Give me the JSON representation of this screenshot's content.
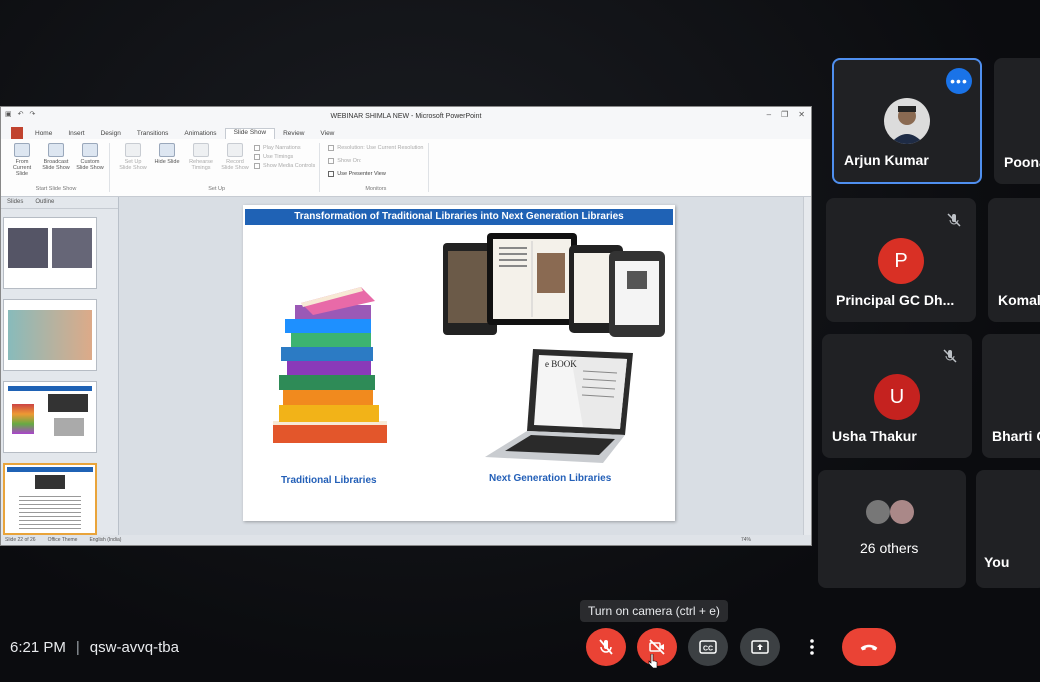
{
  "presentation": {
    "window_title": "WEBINAR SHIMLA NEW - Microsoft PowerPoint",
    "tabs": [
      "Home",
      "Insert",
      "Design",
      "Transitions",
      "Animations",
      "Slide Show",
      "Review",
      "View"
    ],
    "active_tab": "Slide Show",
    "ribbon": {
      "start_group": "Start Slide Show",
      "from_current": "From Current Slide",
      "broadcast": "Broadcast Slide Show",
      "custom": "Custom Slide Show",
      "setup_group": "Set Up",
      "setup_show": "Set Up Slide Show",
      "hide_slide": "Hide Slide",
      "rehearse": "Rehearse Timings",
      "record": "Record Slide Show",
      "play_narrations": "Play Narrations",
      "use_timings": "Use Timings",
      "show_media": "Show Media Controls",
      "monitors_group": "Monitors",
      "resolution": "Resolution: Use Current Resolution",
      "show_on": "Show On:",
      "presenter_view": "Use Presenter View"
    },
    "panel_tabs": [
      "Slides",
      "Outline"
    ],
    "status": {
      "slide": "Slide 22 of 26",
      "theme": "Office Theme",
      "language": "English (India)",
      "zoom": "74%"
    },
    "slide": {
      "title": "Transformation of Traditional Libraries into Next Generation Libraries",
      "left_caption": "Traditional Libraries",
      "right_caption": "Next Generation Libraries",
      "ebook_label": "e BOOK"
    }
  },
  "participants": [
    {
      "name": "Arjun Kumar",
      "initial": "",
      "color": "",
      "active": true
    },
    {
      "name": "Poona",
      "initial": "",
      "color": ""
    },
    {
      "name": "Principal GC Dh...",
      "initial": "P",
      "color": "#d93025",
      "muted": true
    },
    {
      "name": "Komal",
      "initial": "",
      "color": ""
    },
    {
      "name": "Usha Thakur",
      "initial": "U",
      "color": "#c5221f",
      "muted": true
    },
    {
      "name": "Bharti C",
      "initial": "",
      "color": ""
    },
    {
      "name": "26 others",
      "initial": "",
      "color": ""
    },
    {
      "name": "You",
      "initial": "",
      "color": ""
    }
  ],
  "meeting": {
    "time": "6:21 PM",
    "code": "qsw-avvq-tba",
    "tooltip": "Turn on camera (ctrl + e)"
  },
  "colors": {
    "accent": "#1a73e8",
    "danger": "#ea4335",
    "tile": "#202124"
  }
}
